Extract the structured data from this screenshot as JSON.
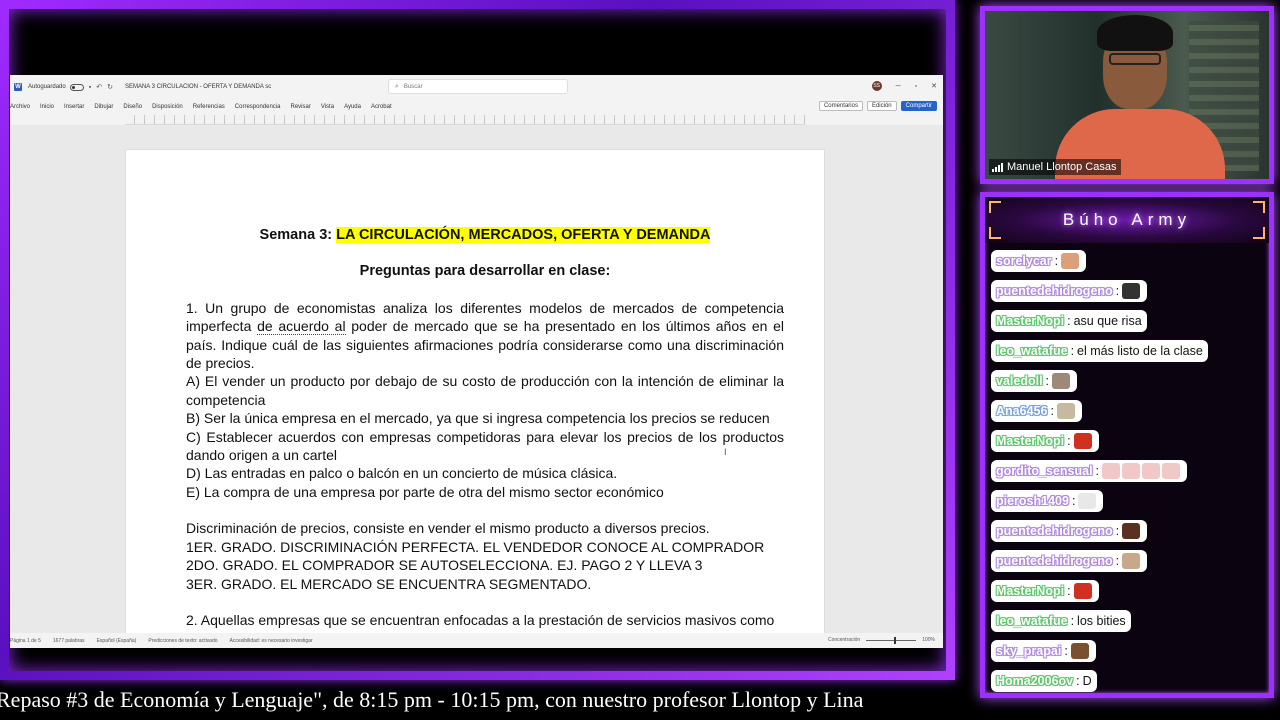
{
  "word": {
    "autosave_label": "Autoguardado",
    "doc_name": "SEMANA 3 CIRCULACION - OFERTA Y DEMANDA sc",
    "search_placeholder": "Buscar",
    "user_initials": "SS",
    "ribbon_tabs": [
      "Archivo",
      "Inicio",
      "Insertar",
      "Dibujar",
      "Diseño",
      "Disposición",
      "Referencias",
      "Correspondencia",
      "Revisar",
      "Vista",
      "Ayuda",
      "Acrobat"
    ],
    "comments_label": "Comentarios",
    "edit_label": "Edición",
    "share_label": "Compartir",
    "status": {
      "page": "Página 1 de 5",
      "words": "1677 palabras",
      "language": "Español (España)",
      "predictions": "Predicciones de texto: activado",
      "accessibility": "Accesibilidad: es necesario investigar",
      "focus": "Concentración",
      "zoom": "100%"
    }
  },
  "doc": {
    "heading_prefix": "Semana 3: ",
    "heading_highlight": "LA CIRCULACIÓN, MERCADOS, OFERTA Y DEMANDA",
    "subheading": "Preguntas para desarrollar en clase:",
    "q1_a": "1. Un grupo de economistas analiza los diferentes modelos de mercados de competencia imperfecta ",
    "q1_link": "de acuerdo al",
    "q1_b": " poder de mercado que se ha presentado en los últimos años en el país. Indique cuál de las siguientes afirmaciones podría considerarse como una discriminación de precios.",
    "opt_a": "A) El vender un producto por debajo de su costo de producción con la intención de eliminar la competencia",
    "opt_b": "B) Ser la única empresa en el mercado, ya que si ingresa competencia los precios se reducen",
    "opt_c": "C) Establecer acuerdos con empresas competidoras para elevar los precios de los productos dando origen a un cartel",
    "opt_d": "D) Las entradas en palco o balcón en un concierto de música clásica.",
    "opt_e": "E) La compra de una empresa por parte de otra del mismo sector económico",
    "note_1": "Discriminación de precios, consiste en vender el mismo producto a diversos precios.",
    "note_2": "1ER. GRADO. DISCRIMINACIÓN PERFECTA. EL VENDEDOR CONOCE AL COMPRADOR",
    "note_3": "2DO. GRADO. EL COMPRADOR SE AUTOSELECCIONA. EJ. PAGO 2 Y LLEVA 3",
    "note_4": "3ER. GRADO. EL MERCADO SE ENCUENTRA SEGMENTADO.",
    "q2": "2. Aquellas empresas que se encuentran enfocadas a la prestación de servicios masivos como"
  },
  "ticker": "Repaso #3 de Economía y Lenguaje\", de 8:15 pm - 10:15 pm, con nuestro profesor Llontop y Lina",
  "webcam": {
    "name": "Manuel Llontop Casas"
  },
  "chat": {
    "title": "Búho Army",
    "messages": [
      {
        "user": "sorelycar",
        "text": "",
        "color": "#b08ae0",
        "emotes": [
          "#d9a07a"
        ]
      },
      {
        "user": "puentedehidrogeno",
        "text": "",
        "color": "#b08ae0",
        "emotes": [
          "#333333"
        ]
      },
      {
        "user": "MasterNopi",
        "text": "asu que risa",
        "color": "#5ec86a",
        "emotes": []
      },
      {
        "user": "leo_watafue",
        "text": "el más listo de la clase",
        "color": "#5ec86a",
        "emotes": []
      },
      {
        "user": "valedoll",
        "text": "",
        "color": "#5ec86a",
        "emotes": [
          "#a08878"
        ]
      },
      {
        "user": "Ana6456",
        "text": "",
        "color": "#7aa0e0",
        "emotes": [
          "#c8b8a0"
        ]
      },
      {
        "user": "MasterNopi",
        "text": "",
        "color": "#5ec86a",
        "emotes": [
          "#d03020"
        ]
      },
      {
        "user": "gordito_sensual",
        "text": "",
        "color": "#b08ae0",
        "emotes": [
          "#f0c8c8",
          "#f0c8c8",
          "#f0c8c8",
          "#f0c8c8"
        ]
      },
      {
        "user": "pierosh1409",
        "text": "",
        "color": "#b08ae0",
        "emotes": [
          "#e8e8e8"
        ]
      },
      {
        "user": "puentedehidrogeno",
        "text": "",
        "color": "#b08ae0",
        "emotes": [
          "#5a3020"
        ]
      },
      {
        "user": "puentedehidrogeno",
        "text": "",
        "color": "#b08ae0",
        "emotes": [
          "#c8a888"
        ]
      },
      {
        "user": "MasterNopi",
        "text": "",
        "color": "#5ec86a",
        "emotes": [
          "#d03020"
        ]
      },
      {
        "user": "leo_watafue",
        "text": "los bities",
        "color": "#5ec86a",
        "emotes": []
      },
      {
        "user": "sky_prapai",
        "text": "",
        "color": "#b08ae0",
        "emotes": [
          "#7a5030"
        ]
      },
      {
        "user": "Homa2006ov",
        "text": "D",
        "color": "#5ec86a",
        "emotes": []
      }
    ]
  },
  "colors": {
    "accent": "#9b30ff",
    "highlight": "#ffff00",
    "share_button": "#2563c9"
  }
}
